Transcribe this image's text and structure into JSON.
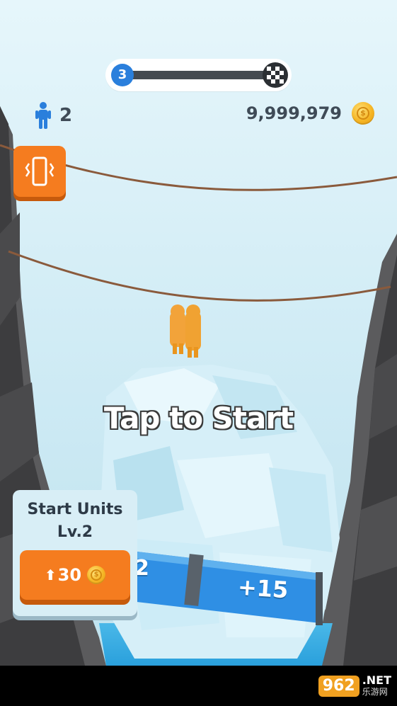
{
  "hud": {
    "level": "3",
    "units_count": "2",
    "coins": "9,999,979",
    "progress_icons": [
      "level-badge",
      "finish-flag-icon"
    ]
  },
  "center_prompt": "Tap to Start",
  "upgrade": {
    "title": "Start Units Lv.2",
    "arrow": "⬆",
    "cost": "30"
  },
  "gates": {
    "left_label": "2",
    "right_label": "+15"
  },
  "watermark": {
    "logo": "962",
    "domain": ".NET",
    "subtitle": "乐游网"
  },
  "colors": {
    "accent_orange": "#f57c1f",
    "level_blue": "#2a7fdc",
    "sky": "#cdeaf4"
  }
}
